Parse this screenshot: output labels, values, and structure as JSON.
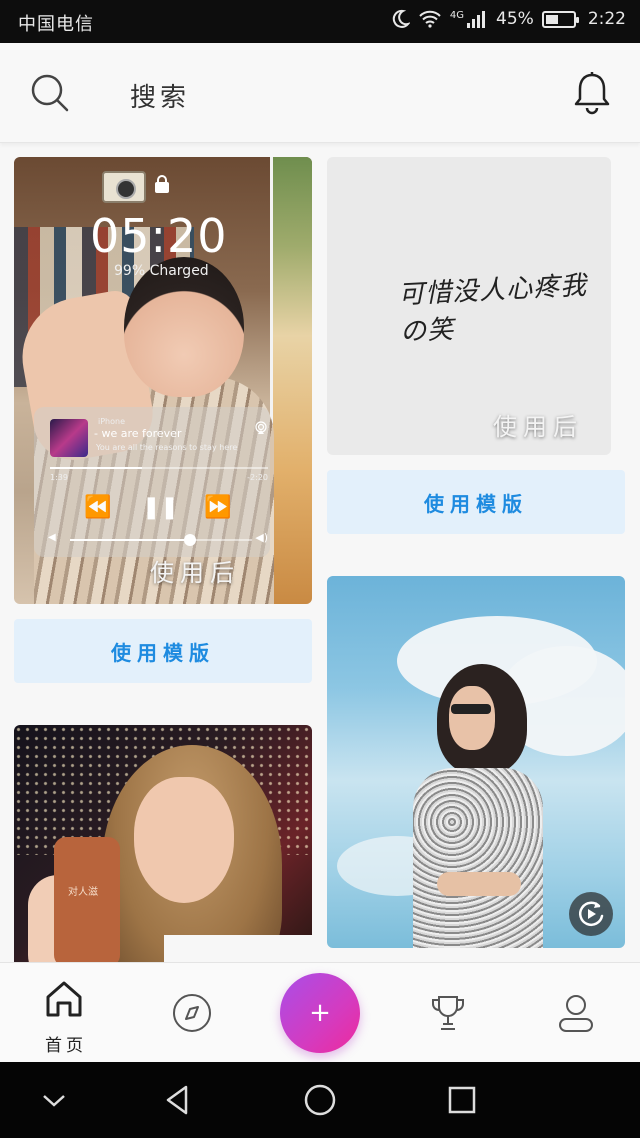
{
  "status_bar": {
    "carrier": "中国电信",
    "network": "4G",
    "battery_percent": "45%",
    "battery_level": 0.45,
    "time": "2:22"
  },
  "header": {
    "search_label": "搜索",
    "icons": [
      "search-icon",
      "bell-icon"
    ]
  },
  "cards": [
    {
      "after_label": "使用后",
      "lockscreen": {
        "time": "05:20",
        "charged": "99% Charged",
        "device": "iPhone",
        "song_title": "- we are forever",
        "song_subtitle": "You are all the reasons to stay here",
        "elapsed": "1:39",
        "remaining": "-2:20",
        "progress": 0.42,
        "volume": 0.66
      },
      "button_label": "使用模版"
    },
    {
      "script_text": "可惜没人心疼我の笑",
      "after_label": "使用后",
      "button_label": "使用模版"
    },
    {
      "icons": [
        "replay-icon"
      ]
    },
    {
      "phone_case_text": "对人滋"
    }
  ],
  "tabbar": {
    "home_label": "首页",
    "fab_symbol": "+",
    "icons": [
      "home-icon",
      "compass-icon",
      "trophy-icon",
      "profile-icon"
    ]
  },
  "navbar": {
    "icons": [
      "chevron-down-icon",
      "back-icon",
      "home-circle-icon",
      "recents-icon"
    ]
  },
  "colors": {
    "accent_blue": "#1e8be0",
    "button_bg": "#e3f0fb",
    "fab_gradient_start": "#a94ee8",
    "fab_gradient_end": "#ee2a9c"
  }
}
